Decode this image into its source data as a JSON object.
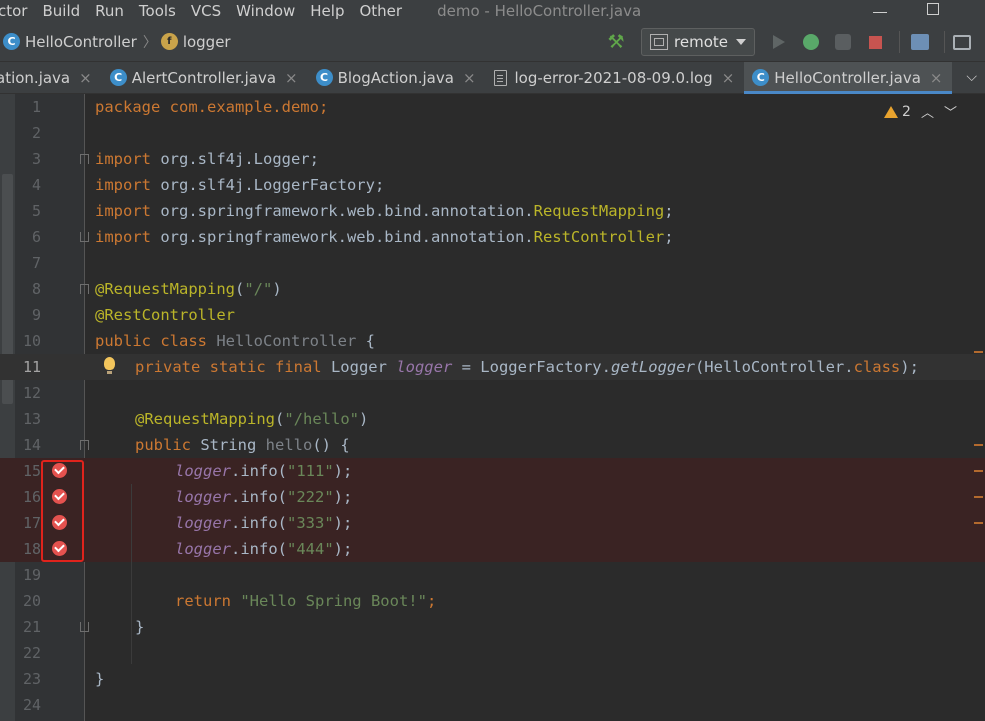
{
  "menu": {
    "items": [
      "ctor",
      "Build",
      "Run",
      "Tools",
      "VCS",
      "Window",
      "Help",
      "Other"
    ],
    "window_title": "demo - HelloController.java"
  },
  "navbar": {
    "crumb_class": "HelloController",
    "crumb_field": "logger",
    "run_config": "remote"
  },
  "tabs": [
    {
      "label": "ation.java",
      "icon": "none",
      "active": false
    },
    {
      "label": "AlertController.java",
      "icon": "class-icon",
      "active": false
    },
    {
      "label": "BlogAction.java",
      "icon": "class-icon",
      "active": false
    },
    {
      "label": "log-error-2021-08-09.0.log",
      "icon": "file-icon",
      "active": false
    },
    {
      "label": "HelloController.java",
      "icon": "class-icon",
      "active": true
    }
  ],
  "tab_close": "×",
  "editor": {
    "warning_count": "2",
    "line_numbers": [
      "1",
      "2",
      "3",
      "4",
      "5",
      "6",
      "7",
      "8",
      "9",
      "10",
      "11",
      "12",
      "13",
      "14",
      "15",
      "16",
      "17",
      "18",
      "19",
      "20",
      "21",
      "22",
      "23",
      "24"
    ],
    "code": {
      "l1": [
        "package com.example.demo;"
      ],
      "l3": [
        "import",
        " org.slf4j.Logger;"
      ],
      "l4": [
        "import",
        " org.slf4j.LoggerFactory;"
      ],
      "l5": [
        "import",
        " org.springframework.web.bind.annotation.",
        "RequestMapping",
        ";"
      ],
      "l6": [
        "import",
        " org.springframework.web.bind.annotation.",
        "RestController",
        ";"
      ],
      "l8": [
        "@RequestMapping",
        "(",
        "\"/\"",
        ")"
      ],
      "l9": [
        "@RestController"
      ],
      "l10": [
        "public class ",
        "HelloController",
        " {"
      ],
      "l11": [
        "private static final ",
        "Logger ",
        "logger",
        " = LoggerFactory.",
        "getLogger",
        "(HelloController.",
        "class",
        ");"
      ],
      "l13": [
        "@RequestMapping",
        "(",
        "\"/hello\"",
        ")"
      ],
      "l14": [
        "public ",
        "String ",
        "hello",
        "() {"
      ],
      "l15": [
        "logger",
        ".info(",
        "\"111\"",
        ");"
      ],
      "l16": [
        "logger",
        ".info(",
        "\"222\"",
        ");"
      ],
      "l17": [
        "logger",
        ".info(",
        "\"333\"",
        ");"
      ],
      "l18": [
        "logger",
        ".info(",
        "\"444\"",
        ");"
      ],
      "l20": [
        "return ",
        "\"Hello Spring Boot!\"",
        ";"
      ],
      "l21": [
        "}"
      ],
      "l23": [
        "}"
      ]
    }
  },
  "colors": {
    "keyword": "#cc7832",
    "annotation": "#bbb529",
    "string": "#6a8759",
    "field": "#9876aa",
    "breakpoint": "#e4524f",
    "highlight_box": "#e0231c"
  }
}
